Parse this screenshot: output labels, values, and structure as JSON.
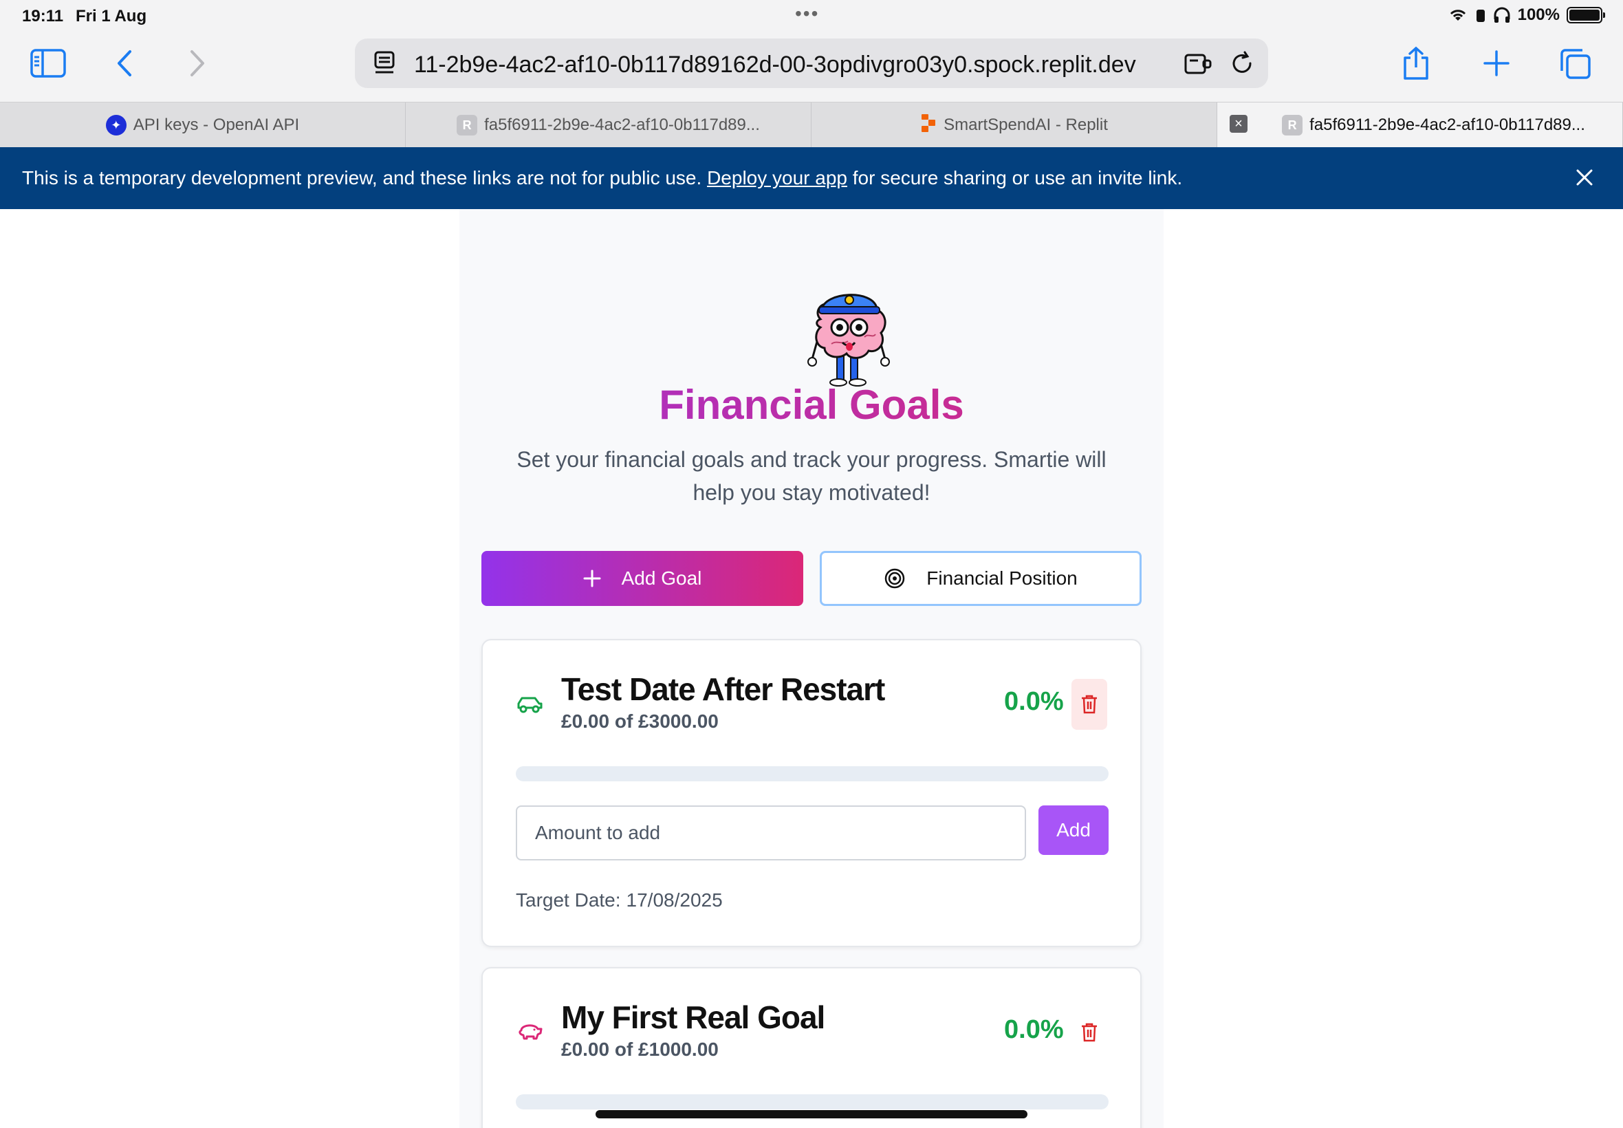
{
  "status_bar": {
    "time": "19:11",
    "date": "Fri 1 Aug",
    "battery": "100%"
  },
  "browser": {
    "url": "11-2b9e-4ac2-af10-0b117d89162d-00-3opdivgro03y0.spock.replit.dev",
    "tabs": [
      {
        "title": "API keys - OpenAI API",
        "favicon": "openai-icon",
        "active": false
      },
      {
        "title": "fa5f6911-2b9e-4ac2-af10-0b117d89...",
        "favicon": "R",
        "active": false
      },
      {
        "title": "SmartSpendAI - Replit",
        "favicon": "replit-icon",
        "active": false
      },
      {
        "title": "fa5f6911-2b9e-4ac2-af10-0b117d89...",
        "favicon": "R",
        "active": true
      }
    ]
  },
  "banner": {
    "text_before": "This is a temporary development preview, and these links are not for public use. ",
    "link": "Deploy your app",
    "text_after": " for secure sharing or use an invite link."
  },
  "page": {
    "title": "Financial Goals",
    "subtitle": "Set your financial goals and track your progress. Smartie will help you stay motivated!",
    "add_goal_label": "Add Goal",
    "financial_position_label": "Financial Position"
  },
  "goals": [
    {
      "name": "Test Date After Restart",
      "amount_text": "£0.00 of £3000.00",
      "percent": "0.0%",
      "progress": 0,
      "icon": "car-icon",
      "input_placeholder": "Amount to add",
      "add_label": "Add",
      "target_label": "Target Date:",
      "target_date": "17/08/2025"
    },
    {
      "name": "My First Real Goal",
      "amount_text": "£0.00 of £1000.00",
      "percent": "0.0%",
      "progress": 0,
      "icon": "piggy-bank-icon"
    }
  ],
  "colors": {
    "accent_purple": "#a855f7",
    "gradient_start": "#9333ea",
    "gradient_end": "#db2777",
    "success_green": "#16a34a",
    "delete_red": "#dc2626",
    "banner_blue": "#03407e"
  }
}
